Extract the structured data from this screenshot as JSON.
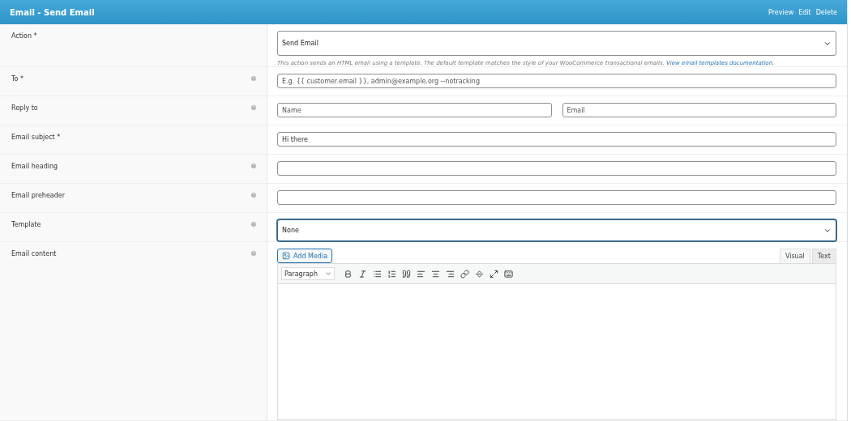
{
  "panel": {
    "title": "Email - Send Email",
    "actions": [
      "Preview",
      "Edit",
      "Delete"
    ]
  },
  "rows": [
    {
      "label": "Action *",
      "help": false,
      "kind": "select",
      "value": "Send Email",
      "focused": false,
      "description": "This action sends an HTML email using a template. The default template matches the style of your WooCommerce transactional emails.",
      "link": "View email templates documentation."
    },
    {
      "label": "To *",
      "help": true,
      "kind": "input",
      "placeholder": "E.g. {{ customer.email }}, admin@example.org --notracking"
    },
    {
      "label": "Reply to",
      "help": true,
      "kind": "pair",
      "placeholders": [
        "Name",
        "Email"
      ]
    },
    {
      "label": "Email subject *",
      "help": false,
      "kind": "input",
      "value": "Hi there"
    },
    {
      "label": "Email heading",
      "help": true,
      "kind": "input"
    },
    {
      "label": "Email preheader",
      "help": true,
      "kind": "input"
    },
    {
      "label": "Template",
      "help": true,
      "kind": "select",
      "value": "None",
      "focused": true
    },
    {
      "label": "Email content",
      "help": true,
      "kind": "editor",
      "media_button": "Add Media",
      "format": "Paragraph",
      "tabs": [
        {
          "label": "Visual",
          "selected": true
        },
        {
          "label": "Text",
          "selected": false
        }
      ]
    }
  ]
}
